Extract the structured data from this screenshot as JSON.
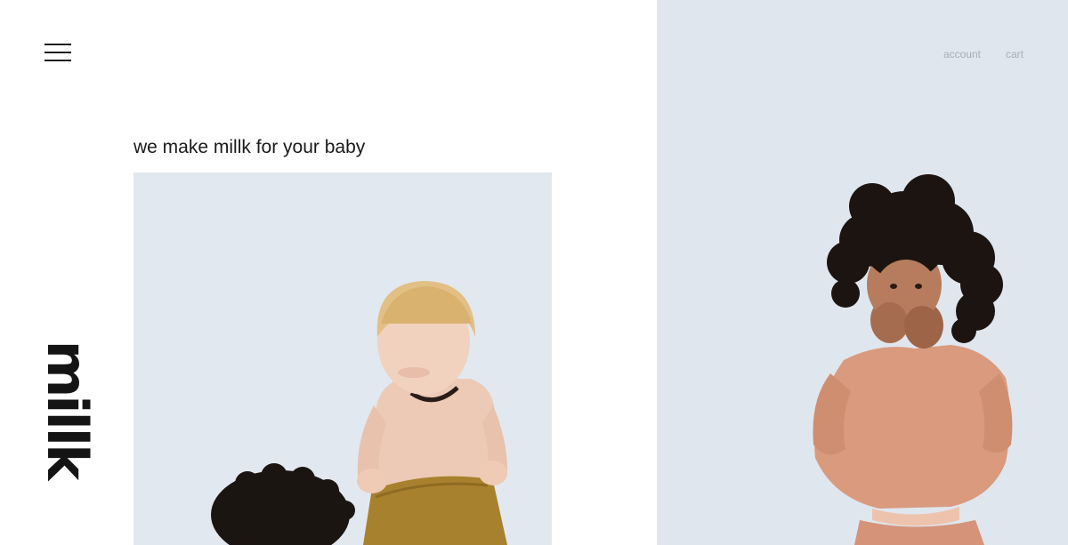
{
  "header": {
    "menu_icon": "hamburger-menu-icon",
    "nav": {
      "account_label": "account",
      "cart_label": "cart"
    }
  },
  "brand": {
    "logo_text": "millk"
  },
  "hero": {
    "tagline": "we make millk for your baby"
  },
  "colors": {
    "photo_background": "#dfe6ee",
    "text": "#1a1a1a",
    "nav_text": "#a8aeb6",
    "shorts_mustard": "#a7812e",
    "outfit_peach": "#d99a7d"
  }
}
